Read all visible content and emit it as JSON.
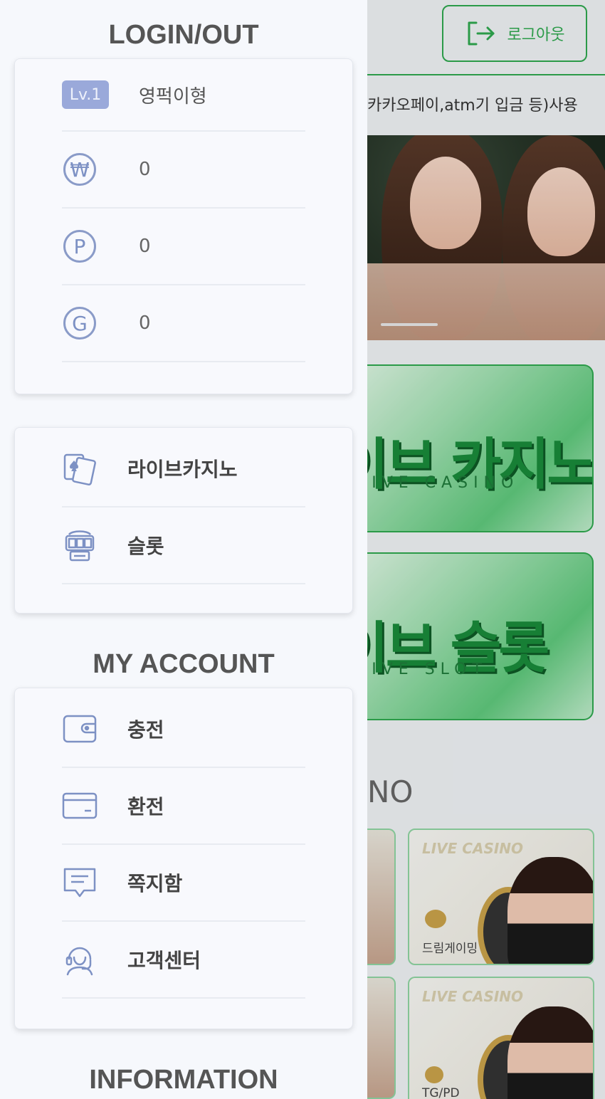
{
  "header": {
    "logout_label": "로그아웃",
    "notice": "카카오페이,atm기 입금 등)사용"
  },
  "tiles": [
    {
      "title": "이브 카지노",
      "subtitle": "LIVE CASINO"
    },
    {
      "title": "이브 슬롯",
      "subtitle": "LIVE SLOT"
    }
  ],
  "section_partial": "NO",
  "provider_cards": [
    {
      "badge": "LIVE CASINO",
      "name": "드림게이밍"
    },
    {
      "badge": "LIVE CASINO",
      "name": "TG/PD"
    }
  ],
  "drawer": {
    "login_title": "LOGIN/OUT",
    "level_badge": "Lv.1",
    "username": "영퍽이형",
    "balance_won": "0",
    "balance_point": "0",
    "balance_g": "0",
    "won_symbol": "₩",
    "point_symbol": "P",
    "g_symbol": "G",
    "games": [
      {
        "label": "라이브카지노",
        "icon": "playing-cards-icon"
      },
      {
        "label": "슬롯",
        "icon": "slot-machine-icon"
      }
    ],
    "account_title": "MY ACCOUNT",
    "account": [
      {
        "label": "충전",
        "icon": "wallet-icon"
      },
      {
        "label": "환전",
        "icon": "credit-card-icon"
      },
      {
        "label": "쪽지함",
        "icon": "message-icon"
      },
      {
        "label": "고객센터",
        "icon": "support-agent-icon"
      }
    ],
    "information_title": "INFORMATION"
  },
  "colors": {
    "accent_green": "#2fa84f",
    "icon_blue": "#7d91c4",
    "badge_blue": "#9aa9da"
  }
}
